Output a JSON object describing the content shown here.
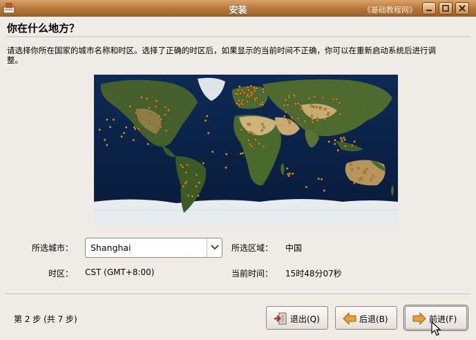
{
  "window": {
    "title": "安装",
    "watermark": "《基础教程网》",
    "icons": {
      "app": "installer-icon",
      "minimize": "minimize-icon",
      "maximize": "maximize-icon",
      "close": "close-icon"
    }
  },
  "page": {
    "heading": "你在什么地方？",
    "description": "请选择你所在国家的城市名称和时区。选择了正确的时区后，如果显示的当前时间不正确，你可以在重新启动系统后进行调整。"
  },
  "map": {
    "icon": "world-map",
    "colors": {
      "ocean": "#0b2146",
      "land": "#3f5a2a",
      "desert": "#c9b07a",
      "ice": "#e8ecef",
      "city_dot": "#e0902a"
    }
  },
  "form": {
    "city_label": "所选城市：",
    "city_value": "Shanghai",
    "region_label": "所选区域：",
    "region_value": "中国",
    "timezone_label": "时区：",
    "timezone_value": "CST (GMT+8:00)",
    "time_label": "当前时间：",
    "time_value": "15时48分07秒"
  },
  "footer": {
    "step_text": "第 2 步 (共 7 步)",
    "quit_label": "退出(Q)",
    "back_label": "后退(B)",
    "forward_label": "前进(F)",
    "icons": {
      "quit": "exit-icon",
      "back": "arrow-left-icon",
      "forward": "arrow-right-icon"
    },
    "colors": {
      "arrow": "#e8a033"
    }
  }
}
